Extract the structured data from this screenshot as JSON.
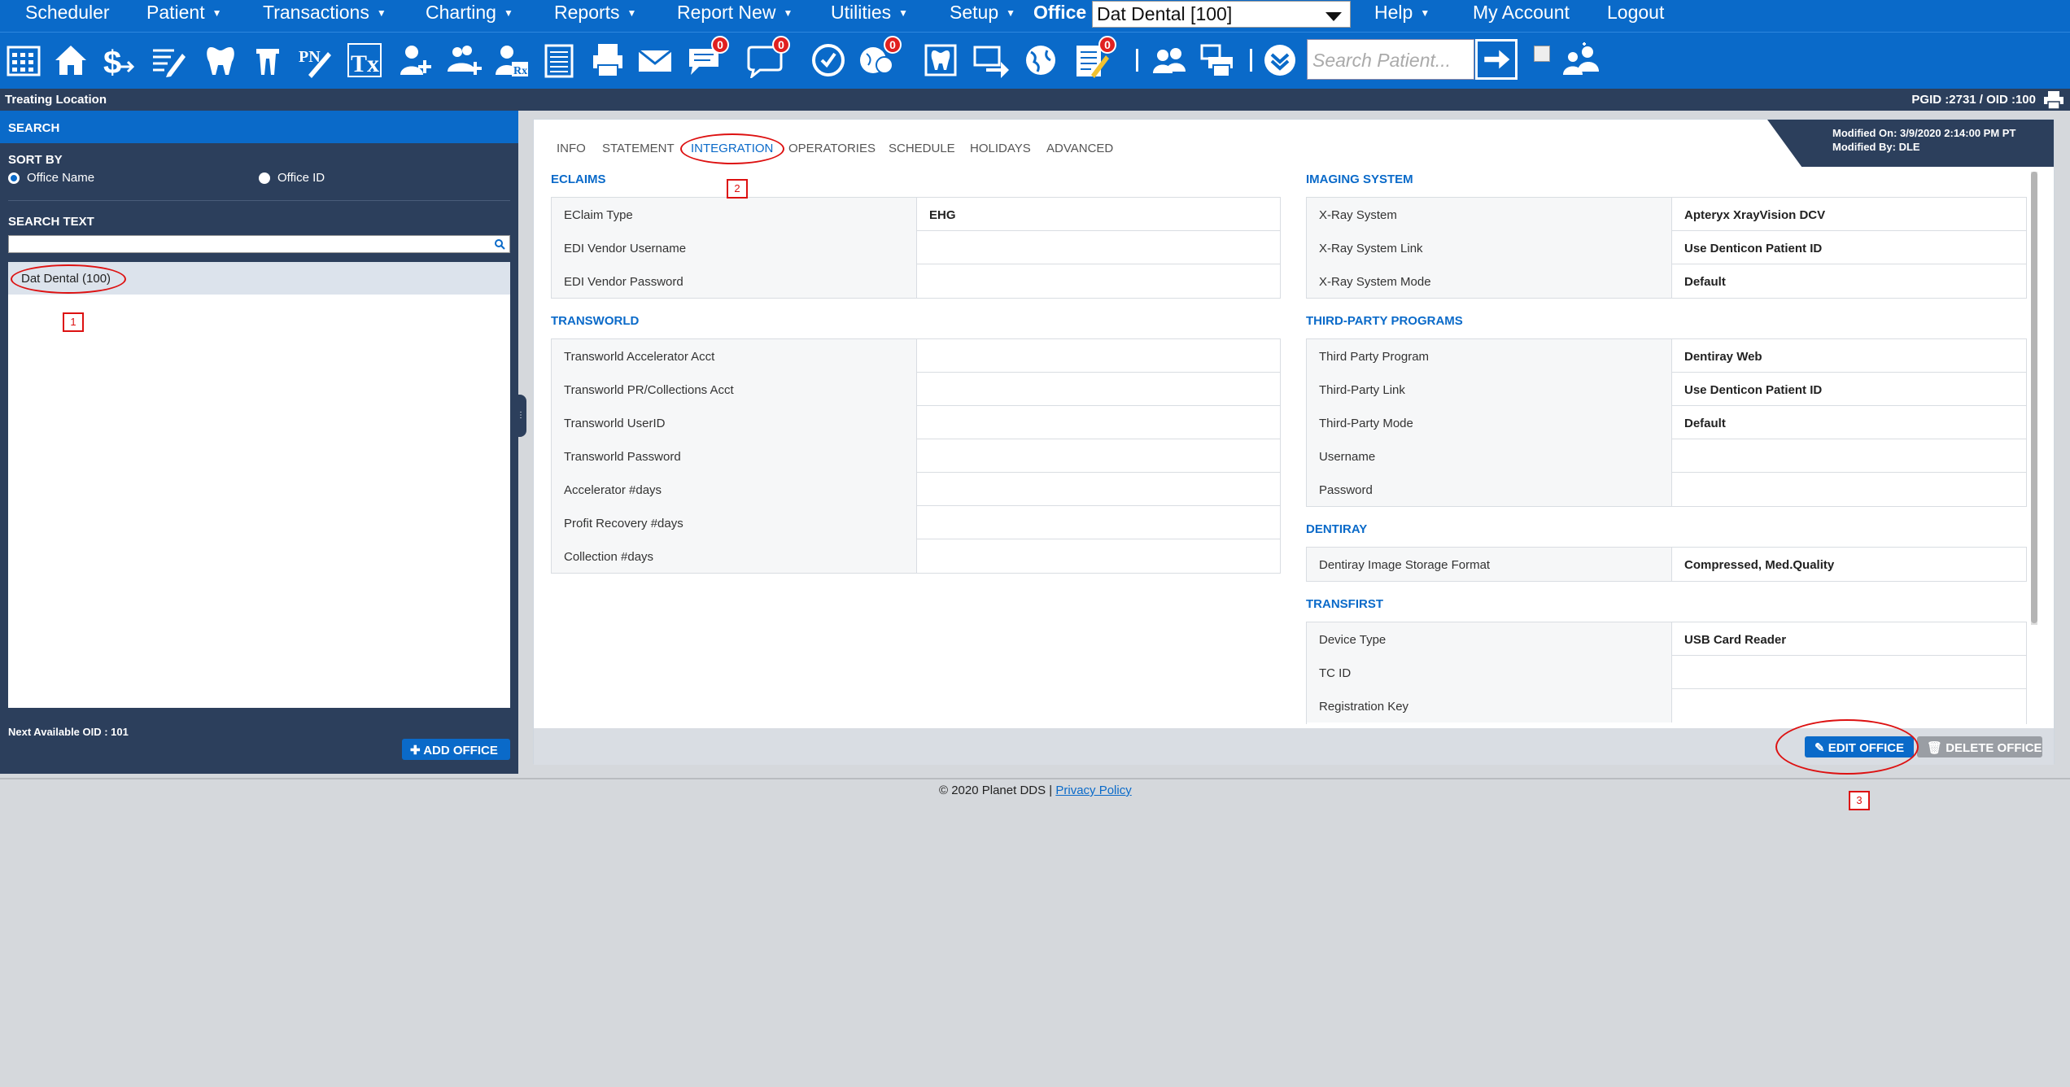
{
  "menu": {
    "items": [
      {
        "label": "Scheduler",
        "caret": false
      },
      {
        "label": "Patient",
        "caret": true
      },
      {
        "label": "Transactions",
        "caret": true
      },
      {
        "label": "Charting",
        "caret": true
      },
      {
        "label": "Reports",
        "caret": true
      },
      {
        "label": "Report New",
        "caret": true
      },
      {
        "label": "Utilities",
        "caret": true
      },
      {
        "label": "Setup",
        "caret": true
      }
    ],
    "office_label": "Office",
    "office_value": "Dat Dental [100]",
    "right_items": [
      {
        "label": "Help",
        "caret": true
      },
      {
        "label": "My Account",
        "caret": false
      },
      {
        "label": "Logout",
        "caret": false
      }
    ]
  },
  "toolbar": {
    "icons": [
      "calendar-icon",
      "home-icon",
      "dollar-icon",
      "notes-icon",
      "tooth-icon",
      "perio-icon",
      "progress-notes-icon",
      "treatment-icon",
      "add-patient-icon",
      "add-family-icon",
      "prescription-icon",
      "document-icon",
      "print-icon",
      "mail-icon",
      "chat-icon",
      "message-icon",
      "clock-icon",
      "world-icon",
      "dental-chart-icon",
      "transfer-icon",
      "globe-icon",
      "checklist-icon",
      "users-icon",
      "print-multi-icon",
      "chevron-down-icon"
    ],
    "badges": {
      "chat-icon": "0",
      "message-icon": "0",
      "world-icon": "0",
      "checklist-icon": "0"
    },
    "search_placeholder": "Search Patient..."
  },
  "strip": {
    "left": "Treating Location",
    "right": "PGID :2731  /  OID :100"
  },
  "sidebar": {
    "header": "SEARCH",
    "sort_by": "SORT BY",
    "radio_office_name": "Office Name",
    "radio_office_id": "Office ID",
    "search_text": "SEARCH TEXT",
    "result": "Dat Dental (100)",
    "next_oid": "Next Available OID : 101",
    "add_office": "ADD OFFICE"
  },
  "tabs": [
    "INFO",
    "STATEMENT",
    "INTEGRATION",
    "OPERATORIES",
    "SCHEDULE",
    "HOLIDAYS",
    "ADVANCED"
  ],
  "active_tab": "INTEGRATION",
  "modified": {
    "on": "Modified On: 3/9/2020 2:14:00 PM PT",
    "by": "Modified By: DLE"
  },
  "left_sections": [
    {
      "title": "ECLAIMS",
      "rows": [
        [
          "EClaim Type",
          "EHG"
        ],
        [
          "EDI Vendor Username",
          ""
        ],
        [
          "EDI Vendor Password",
          ""
        ]
      ]
    },
    {
      "title": "TRANSWORLD",
      "rows": [
        [
          "Transworld Accelerator Acct",
          ""
        ],
        [
          "Transworld PR/Collections Acct",
          ""
        ],
        [
          "Transworld UserID",
          ""
        ],
        [
          "Transworld Password",
          ""
        ],
        [
          "Accelerator #days",
          ""
        ],
        [
          "Profit Recovery #days",
          ""
        ],
        [
          "Collection #days",
          ""
        ]
      ]
    }
  ],
  "right_sections": [
    {
      "title": "IMAGING SYSTEM",
      "rows": [
        [
          "X-Ray System",
          "Apteryx XrayVision DCV"
        ],
        [
          "X-Ray System Link",
          "Use Denticon Patient ID"
        ],
        [
          "X-Ray System Mode",
          "Default"
        ]
      ]
    },
    {
      "title": "THIRD-PARTY PROGRAMS",
      "rows": [
        [
          "Third Party Program",
          "Dentiray Web"
        ],
        [
          "Third-Party Link",
          "Use Denticon Patient ID"
        ],
        [
          "Third-Party Mode",
          "Default"
        ],
        [
          "Username",
          ""
        ],
        [
          "Password",
          ""
        ]
      ]
    },
    {
      "title": "DENTIRAY",
      "rows": [
        [
          "Dentiray Image Storage Format",
          "Compressed, Med.Quality"
        ]
      ]
    },
    {
      "title": "TRANSFIRST",
      "rows": [
        [
          "Device Type",
          "USB Card Reader"
        ],
        [
          "TC ID",
          ""
        ],
        [
          "Registration Key",
          ""
        ]
      ]
    }
  ],
  "buttons": {
    "edit": "EDIT OFFICE",
    "delete": "DELETE OFFICE"
  },
  "footer": {
    "copyright": "© 2020 Planet DDS | ",
    "privacy": "Privacy Policy"
  },
  "annotations": [
    "1",
    "2",
    "3"
  ],
  "colors": {
    "primary": "#0a6ac9",
    "dark": "#2c3f5c",
    "annotation": "#dd1111"
  }
}
